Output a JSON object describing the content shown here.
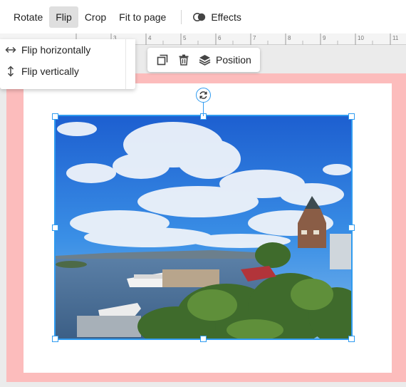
{
  "toolbar": {
    "rotate_label": "Rotate",
    "flip_label": "Flip",
    "crop_label": "Crop",
    "fit_label": "Fit to page",
    "effects_label": "Effects",
    "effects_icon": "effects-icon"
  },
  "ruler": {
    "ticks": [
      "3",
      "4",
      "5",
      "6",
      "7",
      "8",
      "9",
      "10",
      "11"
    ]
  },
  "flip_menu": {
    "items": [
      {
        "label": "Flip horizontally",
        "icon": "flip-horizontal-icon"
      },
      {
        "label": "Flip vertically",
        "icon": "flip-vertical-icon"
      }
    ]
  },
  "element_toolbar": {
    "duplicate_icon": "duplicate-icon",
    "delete_icon": "trash-icon",
    "position_icon": "layers-icon",
    "position_label": "Position"
  },
  "selection": {
    "rotate_icon": "rotate-icon"
  },
  "colors": {
    "selection": "#2f9bf0",
    "bleed": "#fcbcbc",
    "active_tab": "#dfdfdf",
    "canvas_bg": "#ebebeb"
  }
}
